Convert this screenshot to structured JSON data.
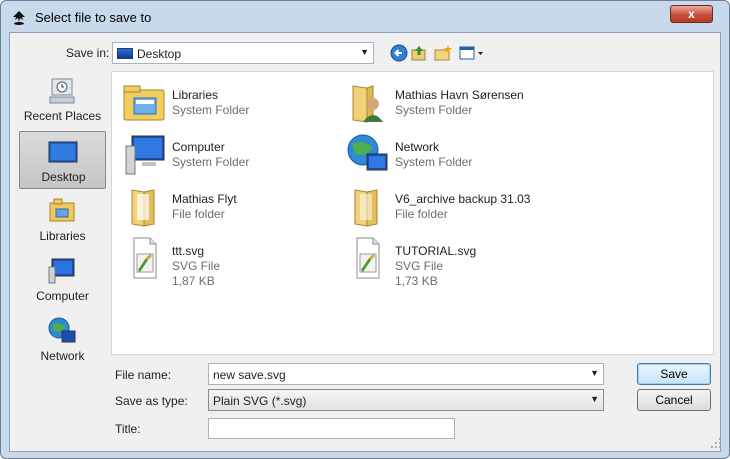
{
  "window": {
    "title": "Select file to save to",
    "close_glyph": "x"
  },
  "toolbar": {
    "save_in_label": "Save in:",
    "location": "Desktop",
    "icons": [
      "back-icon",
      "up-folder-icon",
      "new-folder-icon",
      "views-menu-icon"
    ]
  },
  "places": [
    {
      "label": "Recent Places",
      "icon": "recent-places-icon",
      "selected": false
    },
    {
      "label": "Desktop",
      "icon": "desktop-icon",
      "selected": true
    },
    {
      "label": "Libraries",
      "icon": "libraries-icon",
      "selected": false
    },
    {
      "label": "Computer",
      "icon": "computer-icon",
      "selected": false
    },
    {
      "label": "Network",
      "icon": "network-icon",
      "selected": false
    }
  ],
  "files": [
    {
      "name": "Libraries",
      "type": "System Folder",
      "size": "",
      "icon": "libraries-folder-icon"
    },
    {
      "name": "Mathias Havn Sørensen",
      "type": "System Folder",
      "size": "",
      "icon": "user-folder-icon"
    },
    {
      "name": "Computer",
      "type": "System Folder",
      "size": "",
      "icon": "computer-icon"
    },
    {
      "name": "Network",
      "type": "System Folder",
      "size": "",
      "icon": "network-icon"
    },
    {
      "name": "Mathias Flyt",
      "type": "File folder",
      "size": "",
      "icon": "folder-icon"
    },
    {
      "name": "V6_archive backup 31.03",
      "type": "File folder",
      "size": "",
      "icon": "folder-icon"
    },
    {
      "name": "ttt.svg",
      "type": "SVG File",
      "size": "1,87 KB",
      "icon": "svg-file-icon"
    },
    {
      "name": "TUTORIAL.svg",
      "type": "SVG File",
      "size": "1,73 KB",
      "icon": "svg-file-icon"
    }
  ],
  "form": {
    "file_name_label": "File name:",
    "file_name_value": "new save.svg",
    "save_type_label": "Save as type:",
    "save_type_value": "Plain SVG (*.svg)",
    "title_label": "Title:",
    "title_value": ""
  },
  "buttons": {
    "save": "Save",
    "cancel": "Cancel"
  }
}
